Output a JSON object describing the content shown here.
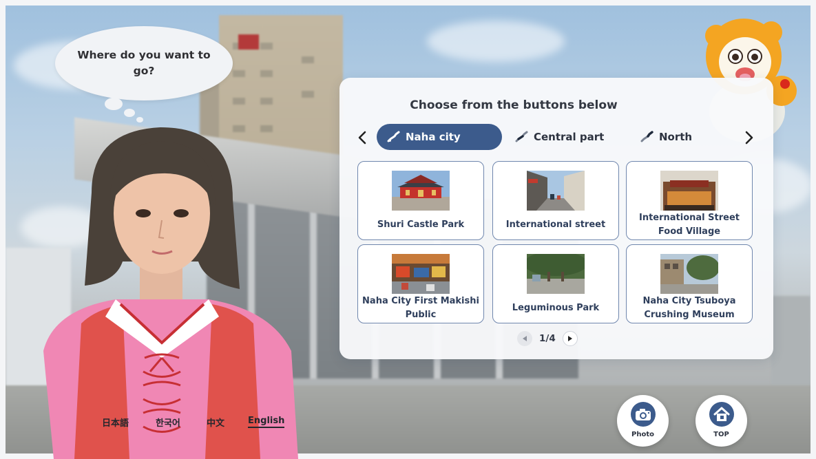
{
  "speech_bubble": {
    "text": "Where do you want to go?"
  },
  "panel": {
    "title": "Choose from the buttons below",
    "tabs": [
      {
        "label": "Naha city",
        "active": true,
        "icon": "okinawa-map-icon"
      },
      {
        "label": "Central part",
        "active": false,
        "icon": "okinawa-map-icon"
      },
      {
        "label": "North",
        "active": false,
        "icon": "okinawa-map-icon"
      }
    ],
    "places": [
      {
        "label": "Shuri Castle Park",
        "icon": "shuri-castle-photo"
      },
      {
        "label": "International street",
        "icon": "street-photo"
      },
      {
        "label": "International Street Food Village",
        "icon": "food-village-photo"
      },
      {
        "label": "Naha City First Makishi Public",
        "icon": "market-photo"
      },
      {
        "label": "Leguminous Park",
        "icon": "park-photo"
      },
      {
        "label": "Naha City Tsuboya Crushing Museum",
        "icon": "museum-photo"
      }
    ],
    "pagination": {
      "current": 1,
      "total": 4,
      "text": "1/4"
    }
  },
  "languages": [
    {
      "label": "日本語",
      "active": false
    },
    {
      "label": "한국어",
      "active": false
    },
    {
      "label": "中文",
      "active": false
    },
    {
      "label": "English",
      "active": true
    }
  ],
  "buttons": {
    "photo": {
      "label": "Photo",
      "icon": "camera-icon"
    },
    "top": {
      "label": "TOP",
      "icon": "home-icon"
    }
  },
  "colors": {
    "accent": "#3c5b8c",
    "card_border": "#6f86ad",
    "text_dark": "#2f3f5c"
  }
}
